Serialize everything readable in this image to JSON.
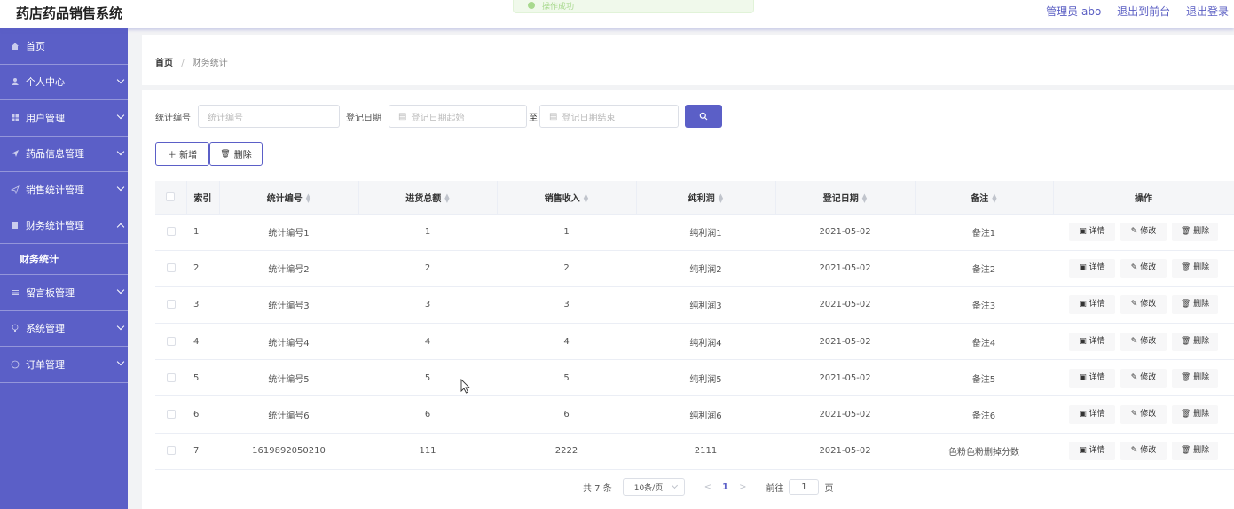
{
  "app": {
    "title": "药店药品销售系统"
  },
  "toast": {
    "message": "操作成功"
  },
  "header": {
    "admin": "管理员 abo",
    "front": "退出到前台",
    "logout": "退出登录"
  },
  "sidebar": {
    "items": [
      {
        "label": "首页",
        "icon": "home-icon"
      },
      {
        "label": "个人中心",
        "icon": "user-icon"
      },
      {
        "label": "用户管理",
        "icon": "grid-icon"
      },
      {
        "label": "药品信息管理",
        "icon": "send-icon"
      },
      {
        "label": "销售统计管理",
        "icon": "send-icon"
      },
      {
        "label": "财务统计管理",
        "icon": "doc-icon"
      },
      {
        "label": "财务统计",
        "icon": ""
      },
      {
        "label": "留言板管理",
        "icon": "list-icon"
      },
      {
        "label": "系统管理",
        "icon": "bulb-icon"
      },
      {
        "label": "订单管理",
        "icon": "circle-icon"
      }
    ]
  },
  "breadcrumb": {
    "home": "首页",
    "sep": "/",
    "current": "财务统计"
  },
  "search": {
    "code_label": "统计编号",
    "code_placeholder": "统计编号",
    "date_label": "登记日期",
    "date_start_placeholder": "登记日期起始",
    "to": "至",
    "date_end_placeholder": "登记日期结束"
  },
  "actions": {
    "add": "＋ 新增",
    "delete": "删除"
  },
  "table": {
    "headers": {
      "index": "索引",
      "code": "统计编号",
      "purchase": "进货总额",
      "sales": "销售收入",
      "profit": "纯利润",
      "date": "登记日期",
      "remark": "备注",
      "ops": "操作"
    },
    "ops": {
      "detail": "详情",
      "edit": "修改",
      "delete": "删除"
    },
    "rows": [
      {
        "index": "1",
        "code": "统计编号1",
        "purchase": "1",
        "sales": "1",
        "profit": "纯利润1",
        "date": "2021-05-02",
        "remark": "备注1"
      },
      {
        "index": "2",
        "code": "统计编号2",
        "purchase": "2",
        "sales": "2",
        "profit": "纯利润2",
        "date": "2021-05-02",
        "remark": "备注2"
      },
      {
        "index": "3",
        "code": "统计编号3",
        "purchase": "3",
        "sales": "3",
        "profit": "纯利润3",
        "date": "2021-05-02",
        "remark": "备注3"
      },
      {
        "index": "4",
        "code": "统计编号4",
        "purchase": "4",
        "sales": "4",
        "profit": "纯利润4",
        "date": "2021-05-02",
        "remark": "备注4"
      },
      {
        "index": "5",
        "code": "统计编号5",
        "purchase": "5",
        "sales": "5",
        "profit": "纯利润5",
        "date": "2021-05-02",
        "remark": "备注5"
      },
      {
        "index": "6",
        "code": "统计编号6",
        "purchase": "6",
        "sales": "6",
        "profit": "纯利润6",
        "date": "2021-05-02",
        "remark": "备注6"
      },
      {
        "index": "7",
        "code": "1619892050210",
        "purchase": "111",
        "sales": "2222",
        "profit": "2111",
        "date": "2021-05-02",
        "remark": "色粉色粉删掉分数"
      }
    ]
  },
  "pager": {
    "total": "共 7 条",
    "page_size": "10条/页",
    "prev": "<",
    "current": "1",
    "next": ">",
    "goto": "前往",
    "goto_value": "1",
    "page_unit": "页"
  },
  "colors": {
    "accent": "#5b5fc7"
  }
}
